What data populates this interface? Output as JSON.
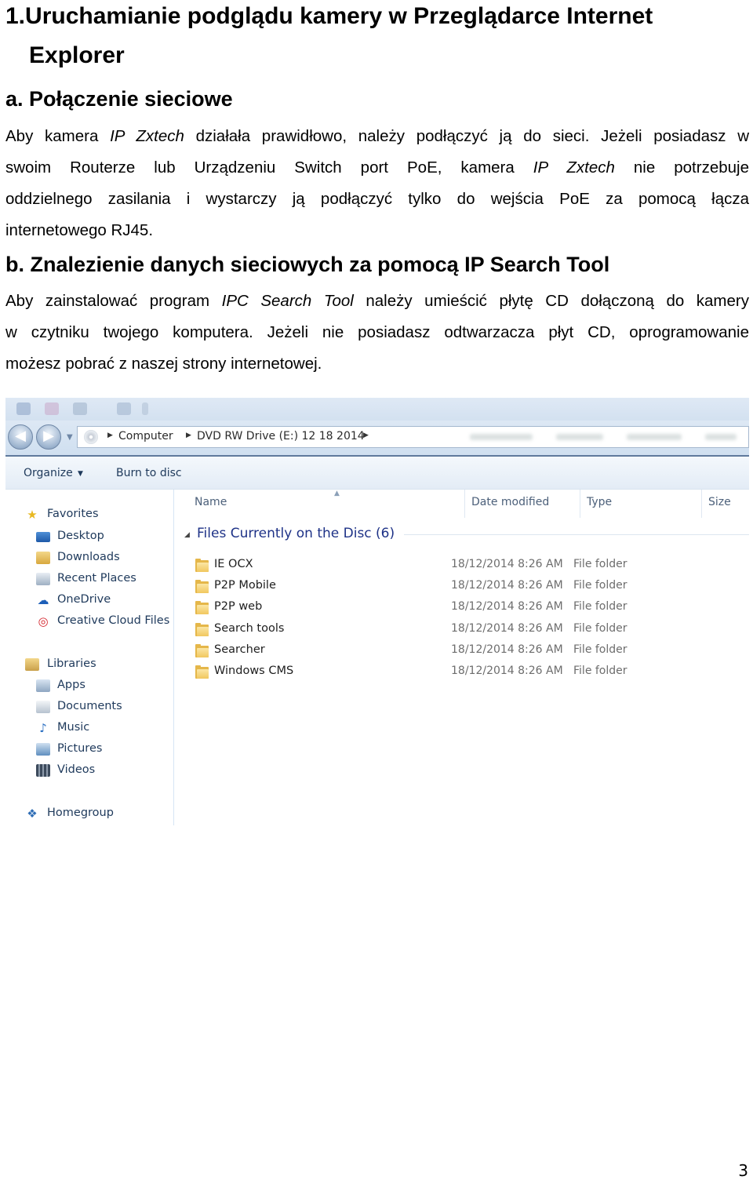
{
  "heading1": {
    "number": "1.",
    "line1": "Uruchamianie podglądu kamery w Przeglądarce Internet",
    "line2": "Explorer"
  },
  "section_a": {
    "heading": "a. Połączenie sieciowe",
    "p_line1_pre": "Aby kamera ",
    "p_line1_em": "IP Zxtech",
    "p_line1_post": " działała prawidłowo, należy podłączyć ją do sieci. Jeżeli posiadasz w",
    "p_line2_pre": "swoim Routerze lub Urządzeniu Switch port PoE, kamera ",
    "p_line2_em": "IP Zxtech",
    "p_line2_post": " nie potrzebuje",
    "p_line3": "oddzielnego zasilania i wystarczy ją podłączyć tylko do wejścia PoE za pomocą łącza",
    "p_line4": "internetowego RJ45."
  },
  "section_b": {
    "heading": "b. Znalezienie danych sieciowych za pomocą IP Search Tool",
    "p_line1_pre": "Aby zainstalować program ",
    "p_line1_em": "IPC Search Tool",
    "p_line1_post": " należy umieścić płytę CD dołączoną do kamery",
    "p_line2": "w czytniku twojego komputera. Jeżeli nie posiadasz odtwarzacza płyt CD, oprogramowanie",
    "p_line3": "możesz pobrać z naszej strony internetowej."
  },
  "explorer": {
    "breadcrumb": [
      "Computer",
      "DVD RW Drive (E:) 12 18 2014"
    ],
    "commands": {
      "organize": "Organize",
      "burn": "Burn to disc"
    },
    "nav_favorites": [
      {
        "label": "Favorites",
        "icon": "star-icon"
      },
      {
        "label": "Desktop",
        "icon": "desktop-icon"
      },
      {
        "label": "Downloads",
        "icon": "downloads-icon"
      },
      {
        "label": "Recent Places",
        "icon": "recent-places-icon"
      },
      {
        "label": "OneDrive",
        "icon": "onedrive-icon"
      },
      {
        "label": "Creative Cloud Files",
        "icon": "creative-cloud-icon"
      }
    ],
    "nav_libraries": [
      {
        "label": "Libraries",
        "icon": "libraries-icon"
      },
      {
        "label": "Apps",
        "icon": "apps-icon"
      },
      {
        "label": "Documents",
        "icon": "documents-icon"
      },
      {
        "label": "Music",
        "icon": "music-icon"
      },
      {
        "label": "Pictures",
        "icon": "pictures-icon"
      },
      {
        "label": "Videos",
        "icon": "videos-icon"
      }
    ],
    "nav_homegroup": {
      "label": "Homegroup",
      "icon": "homegroup-icon"
    },
    "columns": {
      "name": "Name",
      "date": "Date modified",
      "type": "Type",
      "size": "Size"
    },
    "group_header": "Files Currently on the Disc (6)",
    "files": [
      {
        "name": "IE OCX",
        "date": "18/12/2014 8:26 AM",
        "type": "File folder"
      },
      {
        "name": "P2P Mobile",
        "date": "18/12/2014 8:26 AM",
        "type": "File folder"
      },
      {
        "name": "P2P web",
        "date": "18/12/2014 8:26 AM",
        "type": "File folder"
      },
      {
        "name": "Search tools",
        "date": "18/12/2014 8:26 AM",
        "type": "File folder"
      },
      {
        "name": "Searcher",
        "date": "18/12/2014 8:26 AM",
        "type": "File folder"
      },
      {
        "name": "Windows CMS",
        "date": "18/12/2014 8:26 AM",
        "type": "File folder"
      }
    ]
  },
  "page_number": "3"
}
